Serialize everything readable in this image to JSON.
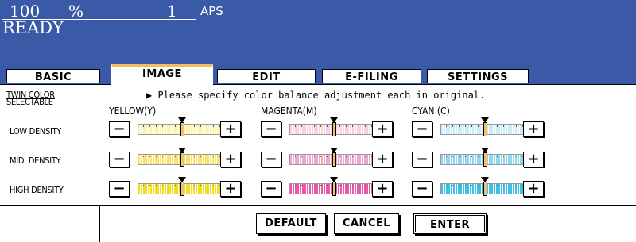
{
  "status": {
    "zoom": "100",
    "zoom_unit": "%",
    "copies": "1",
    "paper": "APS",
    "state": "READY"
  },
  "tabs": [
    {
      "label": "BASIC",
      "active": false
    },
    {
      "label": "IMAGE",
      "active": true
    },
    {
      "label": "EDIT",
      "active": false
    },
    {
      "label": "E-FILING",
      "active": false
    },
    {
      "label": "SETTINGS",
      "active": false
    }
  ],
  "panel": {
    "twin_color_line1": "TWIN COLOR",
    "twin_color_line2": "SELECTABLE",
    "instruction": "▶ Please specify color balance adjustment each in original.",
    "columns": [
      "YELLOW(Y)",
      "MAGENTA(M)",
      "CYAN (C)"
    ],
    "rows": [
      "LOW DENSITY",
      "MID. DENSITY",
      "HIGH DENSITY"
    ],
    "minus_label": "−",
    "plus_label": "+"
  },
  "colors": {
    "status_bg": "#3a5aa8",
    "active_tab_accent": "#f0c060",
    "yellow": [
      "#fdf4b0",
      "#f8e46a",
      "#f4dc20"
    ],
    "magenta": [
      "#f8d0e4",
      "#f0a6cc",
      "#e85aa8"
    ],
    "cyan": [
      "#c8ecf8",
      "#90d6f0",
      "#3cc0e8"
    ]
  },
  "balance_level": 0,
  "footer": {
    "default_label": "DEFAULT",
    "cancel_label": "CANCEL",
    "enter_label": "ENTER"
  }
}
